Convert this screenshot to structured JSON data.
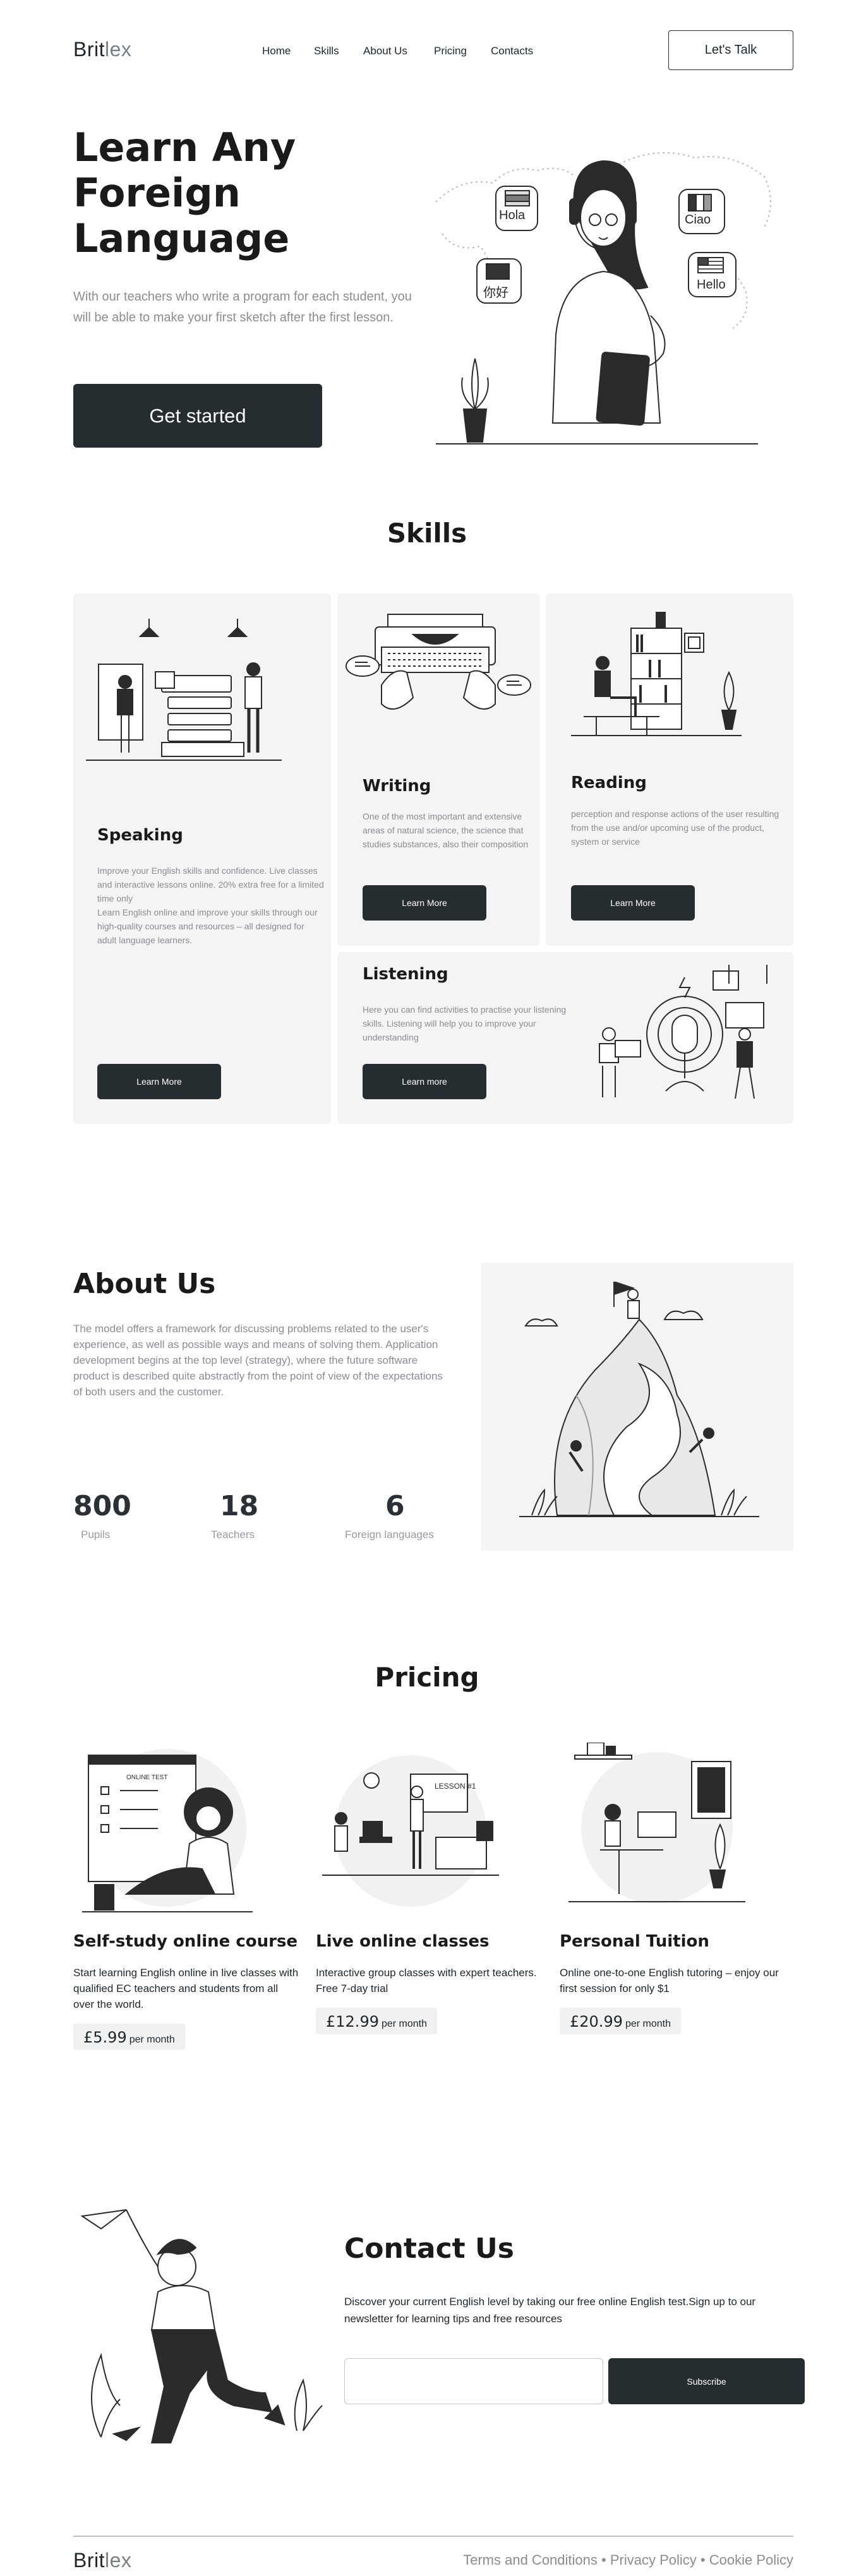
{
  "brand": {
    "part1": "Brit",
    "part2": "lex"
  },
  "nav": {
    "items": [
      {
        "label": "Home"
      },
      {
        "label": "Skills"
      },
      {
        "label": "About Us"
      },
      {
        "label": "Pricing"
      },
      {
        "label": "Contacts"
      }
    ],
    "cta_label": "Let's Talk"
  },
  "hero": {
    "title_line1": "Learn Any",
    "title_line2": "Foreign",
    "title_line3": "Language",
    "subtitle": "With our teachers who write a program for each student, you will be able to make your first sketch after the first lesson.",
    "cta_label": "Get started",
    "bubbles": {
      "hola": "Hola",
      "ciao": "Ciao",
      "hello": "Hello",
      "nihao": "你好"
    }
  },
  "skills": {
    "heading": "Skills",
    "speaking": {
      "title": "Speaking",
      "text": "Improve your English skills and confidence. Live classes and interactive lessons online. 20% extra free for a limited time only\nLearn English online and improve your skills through our high-quality courses and resources – all designed for adult language learners.",
      "button": "Learn More"
    },
    "writing": {
      "title": "Writing",
      "text": "One of the most important and extensive areas of natural science, the science that studies substances, also their composition",
      "button": "Learn More"
    },
    "reading": {
      "title": "Reading",
      "text": "perception and response actions of the user resulting from the use and/or upcoming use of the product, system or service",
      "button": "Learn More"
    },
    "listening": {
      "title": "Listening",
      "text": "Here you can find activities to practise your listening skills. Listening will help you to improve your understanding",
      "button": "Learn more"
    }
  },
  "about": {
    "heading": "About Us",
    "text": "The model offers a framework for discussing problems related to the user's experience, as well as possible ways and means of solving them. Application development begins at the top level (strategy), where the future software product is described quite abstractly from the point of view of the expectations of both users and the customer.",
    "stats": [
      {
        "value": "800",
        "label": "Pupils"
      },
      {
        "value": "18",
        "label": "Teachers"
      },
      {
        "value": "6",
        "label": "Foreign languages"
      }
    ]
  },
  "pricing": {
    "heading": "Pricing",
    "plans": [
      {
        "title": "Self-study online course",
        "text": "Start learning English online in live classes with qualified EC teachers and students from all over the world.",
        "price": "£5.99",
        "period": "per month"
      },
      {
        "title": "Live online classes",
        "text": "Interactive group classes with expert teachers. Free 7-day trial",
        "price": "£12.99",
        "period": "per month"
      },
      {
        "title": "Personal Tuition",
        "text": "Online one-to-one English tutoring – enjoy our first session for only $1",
        "price": "£20.99",
        "period": "per month"
      }
    ],
    "ill_texts": {
      "online_test": "ONLINE TEST",
      "lesson": "LESSON #1"
    }
  },
  "contact": {
    "heading": "Contact Us",
    "text": "Discover your current English level by taking our free online English test.Sign up to our newsletter for learning tips and free resources",
    "input_value": "",
    "input_placeholder": "",
    "button": "Subscribe"
  },
  "footer": {
    "links": [
      {
        "label": "Terms and Conditions"
      },
      {
        "label": "Privacy Policy"
      },
      {
        "label": "Cookie Policy"
      }
    ],
    "separator": "•"
  },
  "colors": {
    "dark": "#262d31",
    "card": "#f4f4f4",
    "muted": "#8c8c92"
  }
}
